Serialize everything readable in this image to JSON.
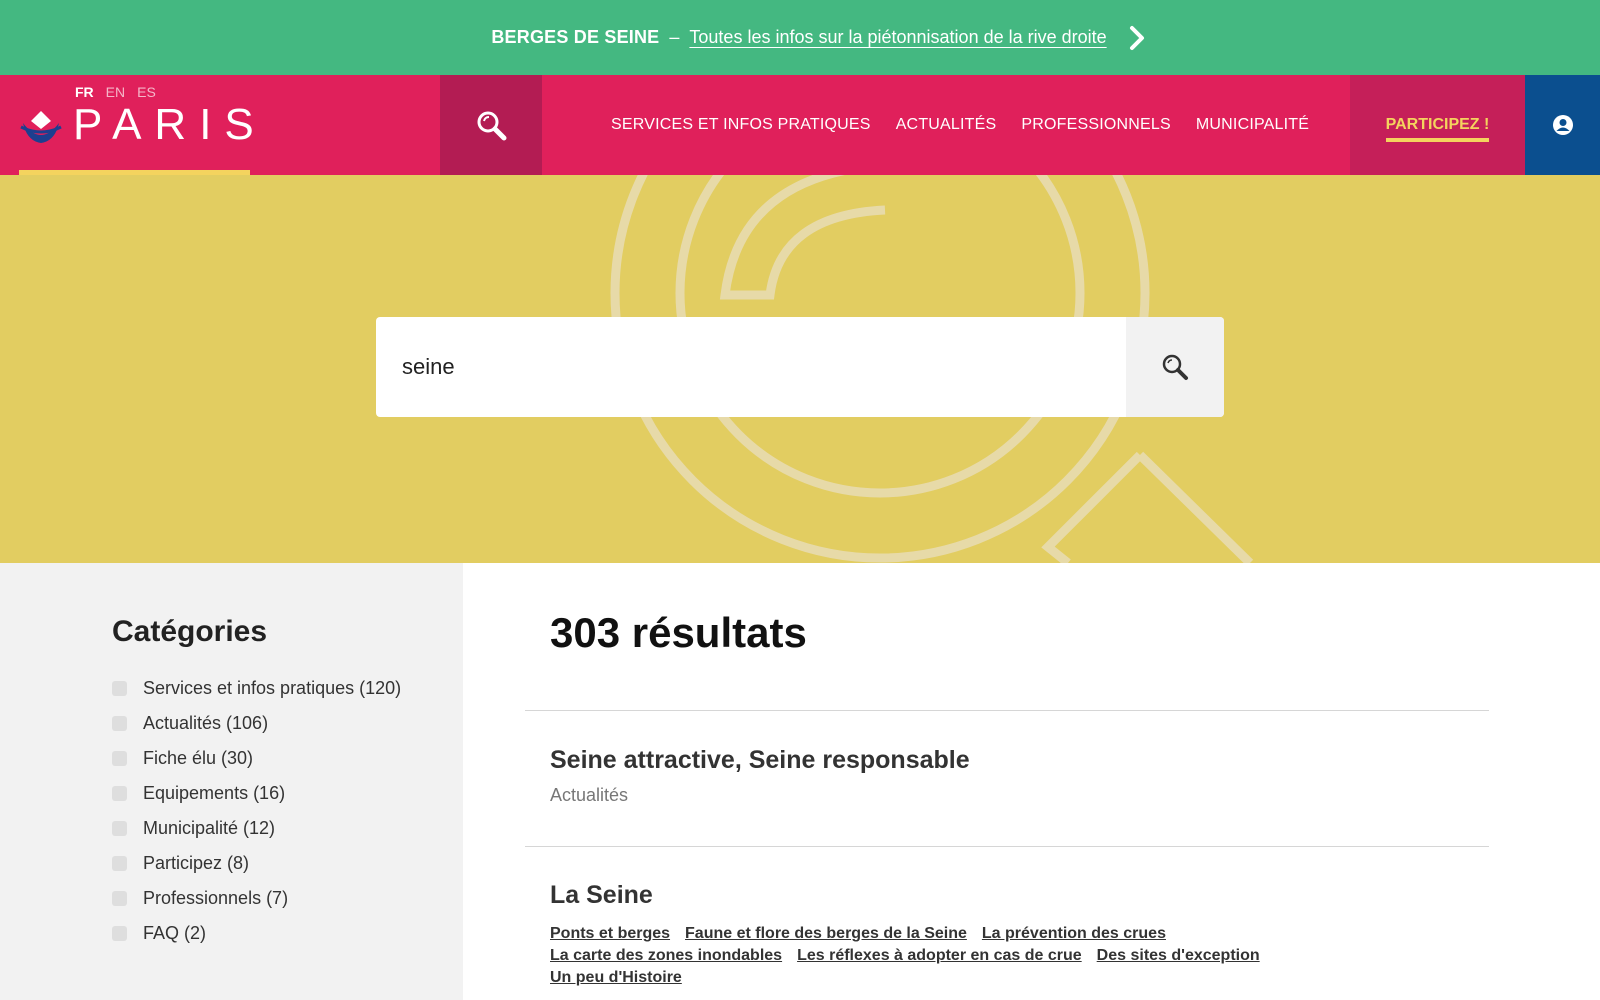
{
  "banner": {
    "title": "BERGES DE SEINE",
    "separator": "–",
    "link_text": "Toutes les infos sur la piétonnisation de la rive droite",
    "chevron_icon": "chevron-right-icon"
  },
  "header": {
    "languages": [
      "FR",
      "EN",
      "ES"
    ],
    "active_language": "FR",
    "logo_text": "PARIS",
    "nav": [
      "SERVICES ET INFOS PRATIQUES",
      "ACTUALITÉS",
      "PROFESSIONNELS",
      "MUNICIPALITÉ"
    ],
    "cta": "PARTICIPEZ !",
    "search_icon": "search-icon",
    "account_icon": "user-icon"
  },
  "search": {
    "value": "seine",
    "icon": "search-icon"
  },
  "sidebar": {
    "title": "Catégories",
    "categories": [
      "Services et infos pratiques (120)",
      "Actualités (106)",
      "Fiche élu (30)",
      "Equipements (16)",
      "Municipalité (12)",
      "Participez (8)",
      "Professionnels (7)",
      "FAQ (2)"
    ]
  },
  "results": {
    "count_label": "303 résultats",
    "items": [
      {
        "title": "Seine attractive, Seine responsable",
        "category": "Actualités"
      },
      {
        "title": "La Seine",
        "links": [
          "Ponts et berges",
          "Faune et flore des berges de la Seine",
          "La prévention des crues",
          "La carte des zones inondables",
          "Les réflexes à adopter en cas de crue",
          "Des sites d'exception",
          "Un peu d'Histoire"
        ]
      }
    ]
  },
  "colors": {
    "banner": "#44b881",
    "header": "#e0205b",
    "header_search_tab": "#b31c53",
    "header_cta_bg": "#c51f59",
    "accent_yellow": "#f4d35e",
    "account_bg": "#0b4f8f",
    "hero": "#e2cd61",
    "sidebar": "#f2f2f2"
  }
}
